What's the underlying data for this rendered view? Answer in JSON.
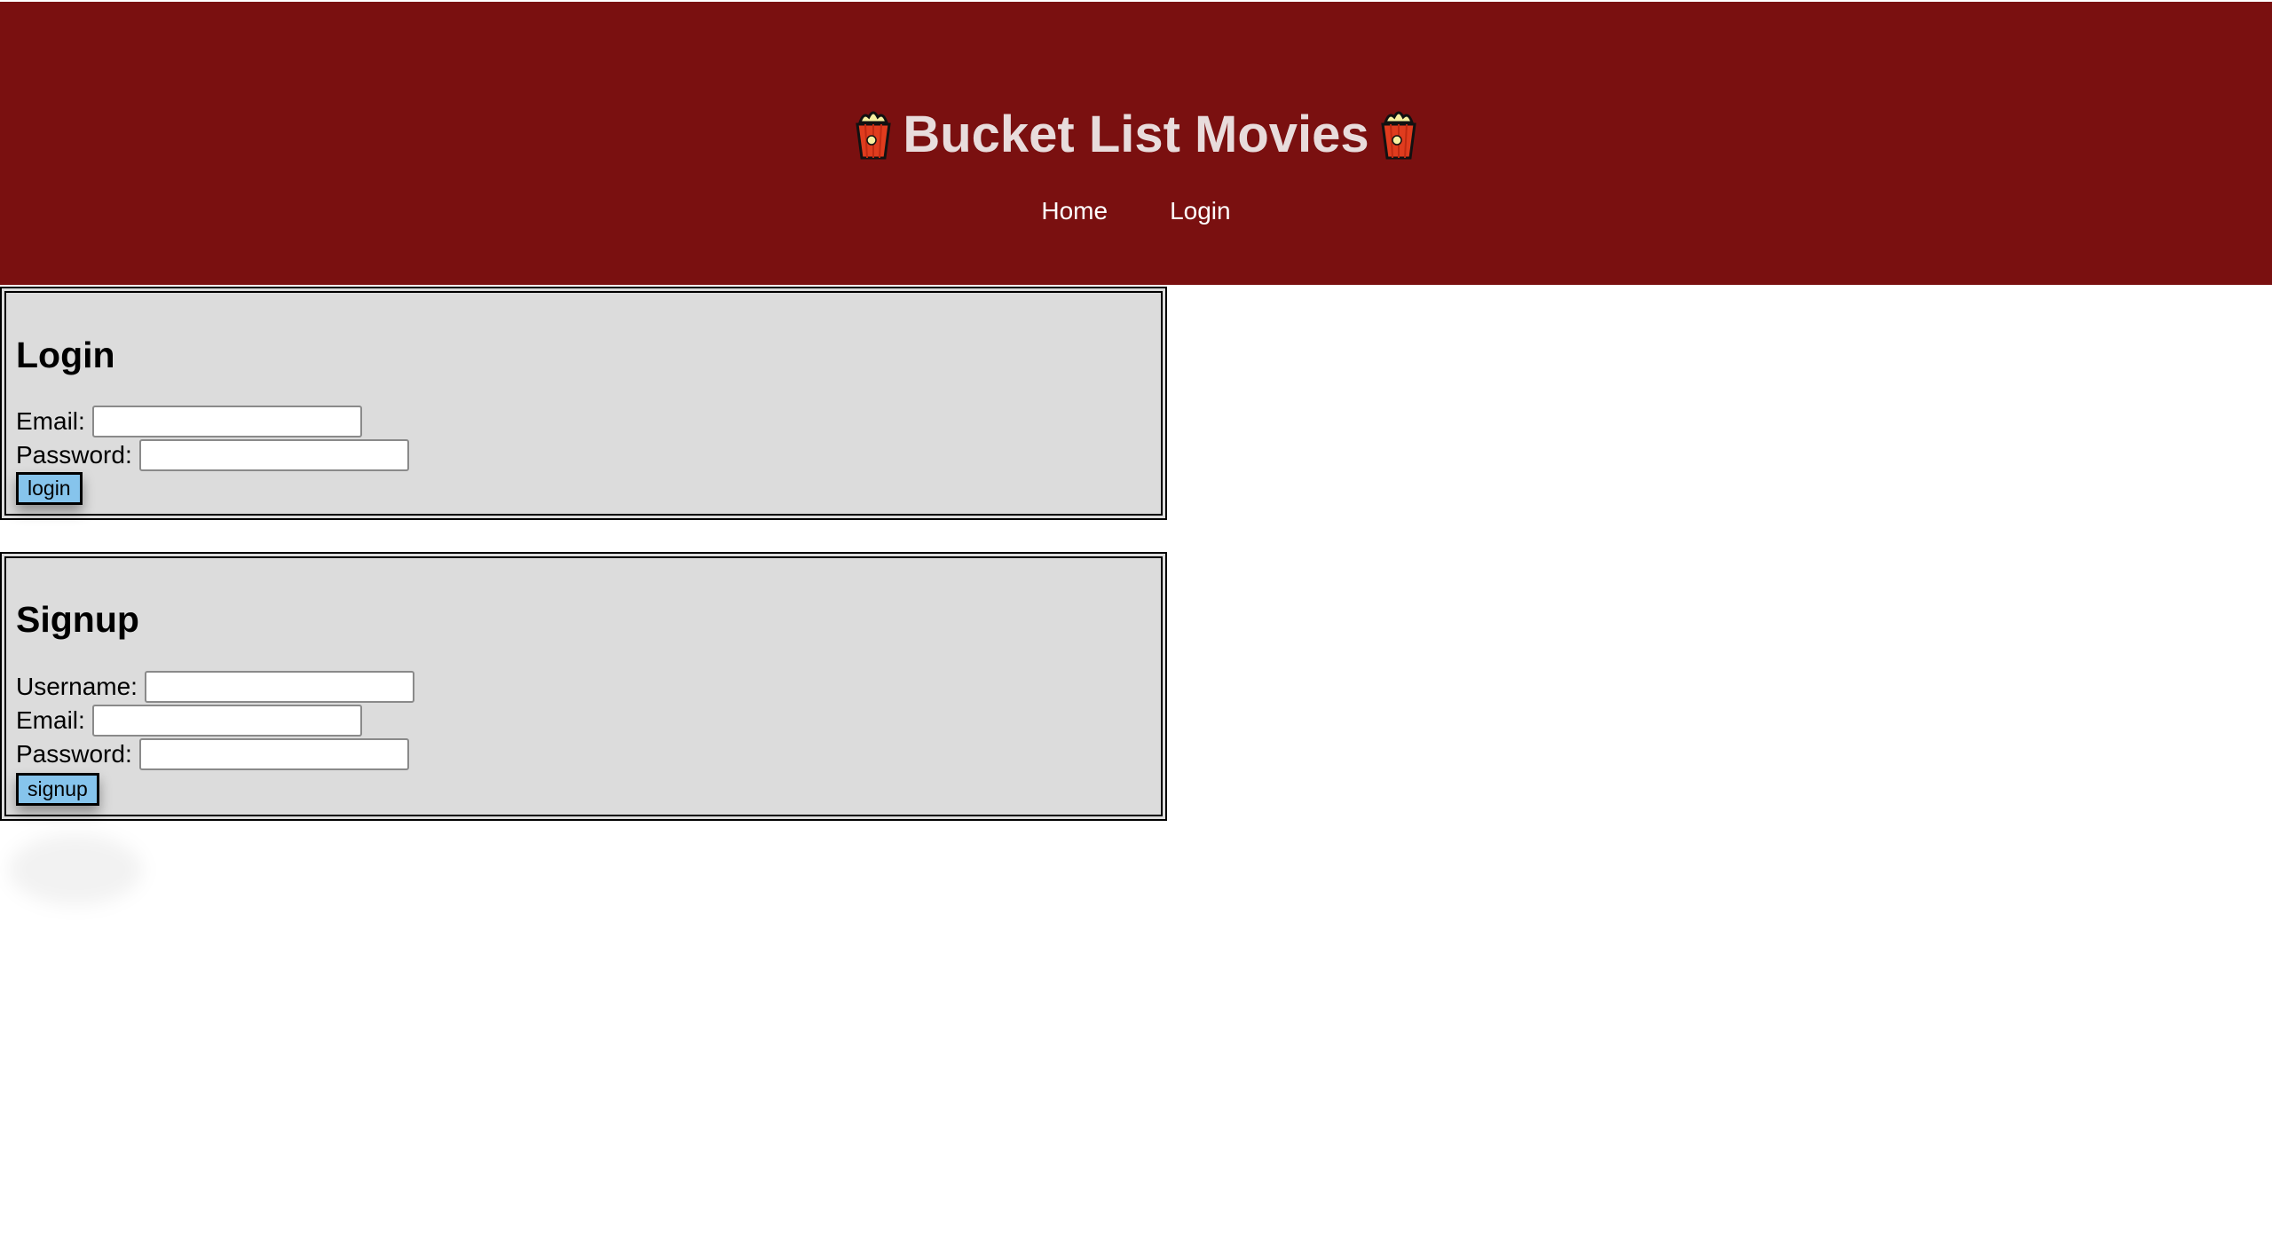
{
  "header": {
    "title": "Bucket List Movies",
    "background_color": "#7a1010",
    "title_color": "#e8dcdc",
    "left_icon": "popcorn-icon",
    "right_icon": "popcorn-icon"
  },
  "nav": {
    "items": [
      {
        "label": "Home"
      },
      {
        "label": "Login"
      }
    ]
  },
  "login_panel": {
    "heading": "Login",
    "email_label": "Email:",
    "email_value": "",
    "password_label": "Password:",
    "password_value": "",
    "submit_label": "login"
  },
  "signup_panel": {
    "heading": "Signup",
    "username_label": "Username:",
    "username_value": "",
    "email_label": "Email:",
    "email_value": "",
    "password_label": "Password:",
    "password_value": "",
    "submit_label": "signup"
  },
  "colors": {
    "panel_background": "#dcdcdc",
    "button_background": "#86c4ec"
  }
}
